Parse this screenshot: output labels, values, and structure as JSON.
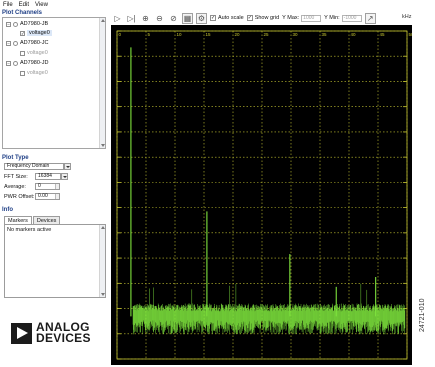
{
  "menu": {
    "file": "File",
    "edit": "Edit",
    "view": "View"
  },
  "plot_channels": {
    "title": "Plot Channels",
    "devices": [
      {
        "name": "AD7980-JB",
        "expanded": true,
        "channels": [
          "voltage0"
        ]
      },
      {
        "name": "AD7980-JC",
        "expanded": true,
        "channels": [
          "voltage0"
        ]
      },
      {
        "name": "AD7980-JD",
        "expanded": true,
        "channels": [
          "voltage0"
        ]
      }
    ]
  },
  "plot_type": {
    "title": "Plot Type",
    "selected": "Frequency Domain",
    "fft_size_label": "FFT Size:",
    "fft_size": "16384",
    "average_label": "Average:",
    "average": "0",
    "pwr_offset_label": "PWR Offset:",
    "pwr_offset": "0.00"
  },
  "info": {
    "title": "Info",
    "tabs": [
      "Markers",
      "Devices"
    ],
    "markers_text": "No markers active"
  },
  "logo": {
    "line1": "ANALOG",
    "line2": "DEVICES"
  },
  "toolbar": {
    "auto_scale": "Auto scale",
    "show_grid": "Show grid",
    "y_max_label": "Y Max:",
    "y_max": "1000",
    "y_min_label": "Y Min:",
    "y_min": "-1000",
    "unit": "kHz"
  },
  "figure_id": "24721-010",
  "colors": {
    "plot_bg": "#000000",
    "grid": "#c8c832",
    "trace": "#7ee33d",
    "axis_text": "#c8c832"
  },
  "chart_data": {
    "type": "line",
    "xlabel": "",
    "ylabel": "",
    "x_unit": "kHz",
    "x_tick_labels": [
      "0",
      "5",
      "10",
      "15",
      "20",
      "25",
      "30",
      "35",
      "40",
      "45",
      "50"
    ],
    "xlim": [
      0,
      50
    ],
    "grid": true,
    "noise_floor_fraction": 0.87,
    "spurs": [
      {
        "x": 2.4,
        "peak_fraction": 0.05
      },
      {
        "x": 15.5,
        "peak_fraction": 0.55
      },
      {
        "x": 29.8,
        "peak_fraction": 0.68
      },
      {
        "x": 37.8,
        "peak_fraction": 0.78
      },
      {
        "x": 44.6,
        "peak_fraction": 0.75
      }
    ]
  }
}
